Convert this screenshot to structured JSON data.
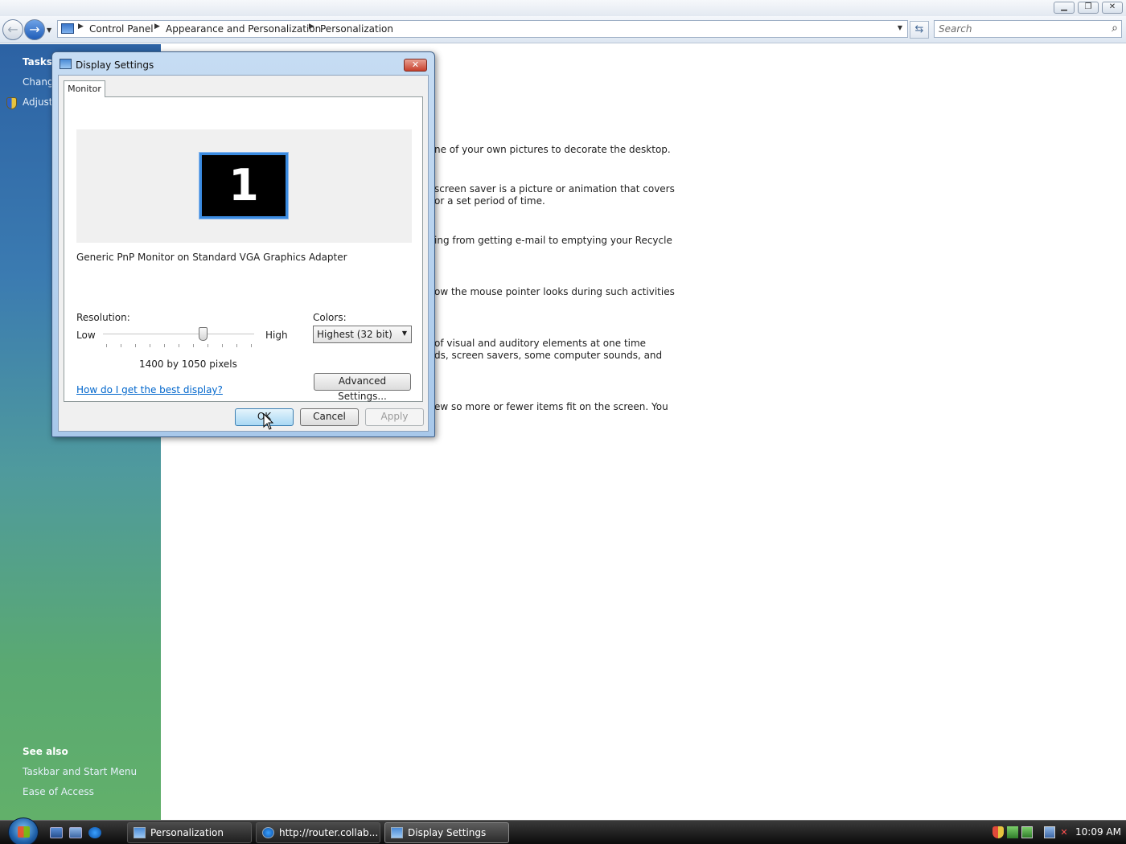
{
  "explorer": {
    "breadcrumbs": [
      "Control Panel",
      "Appearance and Personalization",
      "Personalization"
    ],
    "search_placeholder": "Search"
  },
  "task_pane": {
    "tasks_header": "Tasks",
    "tasks": [
      "Chang",
      "Adjust"
    ],
    "see_also_header": "See also",
    "see_also": [
      "Taskbar and Start Menu",
      "Ease of Access"
    ]
  },
  "content_lines": [
    "ne of your own pictures to decorate the desktop.",
    " screen saver is a picture or animation that covers",
    "or a set period of time.",
    "ing from getting e-mail to emptying your Recycle",
    "ow the mouse pointer looks during such activities",
    "of visual and auditory elements at one time",
    "ds, screen savers, some computer sounds, and",
    "ew so more or fewer items fit on the screen. You"
  ],
  "dialog": {
    "title": "Display Settings",
    "tab": "Monitor",
    "monitor_number": "1",
    "monitor_name": "Generic PnP Monitor on Standard VGA Graphics Adapter",
    "resolution_label": "Resolution:",
    "low_label": "Low",
    "high_label": "High",
    "resolution_slider_fraction": 0.66,
    "resolution_value": "1400 by 1050 pixels",
    "colors_label": "Colors:",
    "colors_value": "Highest (32 bit)",
    "help_link": "How do I get the best display?",
    "advanced_button": "Advanced Settings...",
    "ok_button": "OK",
    "cancel_button": "Cancel",
    "apply_button": "Apply"
  },
  "taskbar": {
    "buttons": [
      "Personalization",
      "http://router.collab...",
      "Display Settings"
    ],
    "active_button": "Display Settings",
    "clock": "10:09 AM"
  },
  "colors": {
    "accent": "#3b8be0",
    "link": "#0066cc"
  }
}
